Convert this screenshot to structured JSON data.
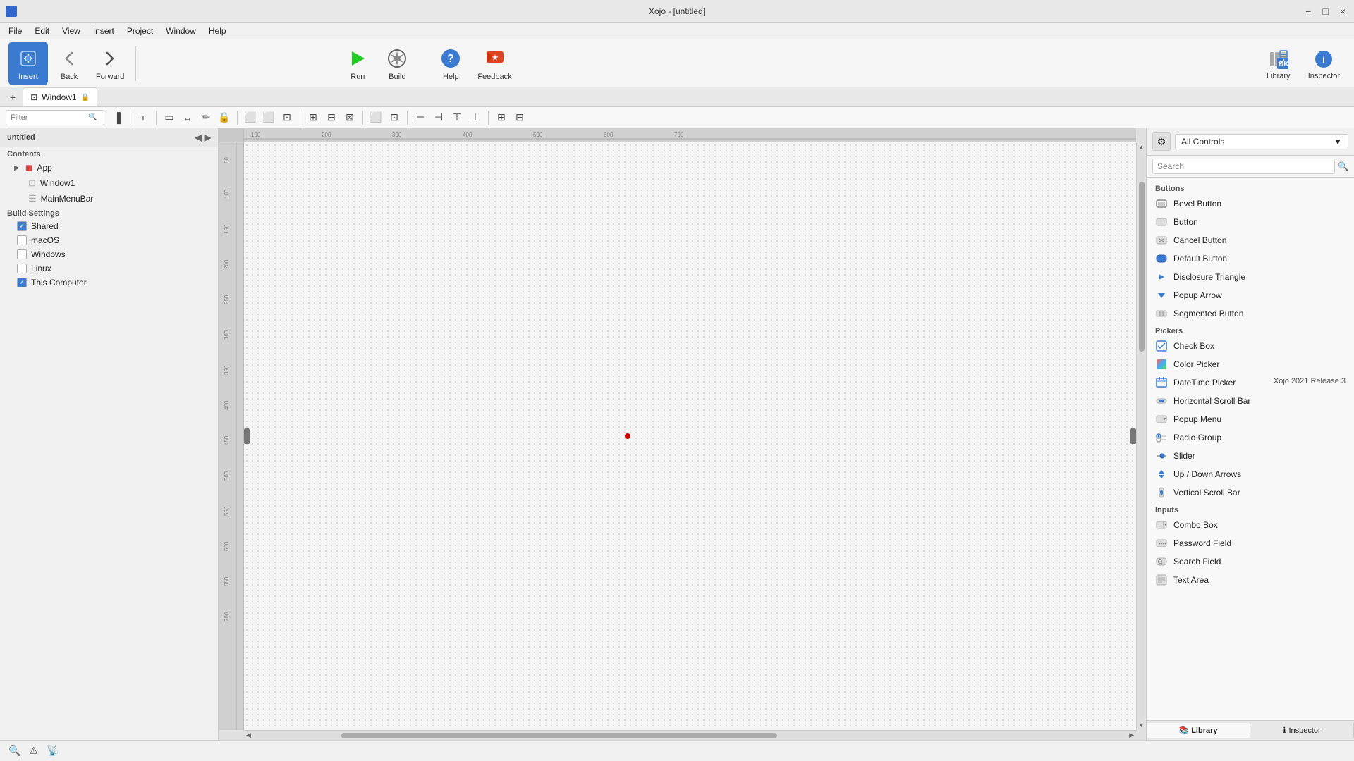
{
  "titlebar": {
    "title": "Xojo - [untitled]",
    "controls": [
      "−",
      "□",
      "×"
    ]
  },
  "menubar": {
    "items": [
      "File",
      "Edit",
      "View",
      "Insert",
      "Project",
      "Window",
      "Help"
    ]
  },
  "toolbar": {
    "insert_label": "Insert",
    "back_label": "Back",
    "forward_label": "Forward",
    "run_label": "Run",
    "build_label": "Build",
    "help_label": "Help",
    "feedback_label": "Feedback",
    "library_label": "Library",
    "inspector_label": "Inspector"
  },
  "tabbar": {
    "active_tab": "Window1",
    "add_label": "+"
  },
  "secondary_toolbar": {
    "filter_placeholder": "Filter"
  },
  "left_panel": {
    "title": "untitled",
    "contents_label": "Contents",
    "items": [
      {
        "id": "app",
        "label": "App",
        "type": "folder",
        "depth": 0
      },
      {
        "id": "window1",
        "label": "Window1",
        "type": "window",
        "depth": 1
      },
      {
        "id": "mainmenubar",
        "label": "MainMenuBar",
        "type": "menu",
        "depth": 1
      }
    ],
    "build_settings_label": "Build Settings",
    "build_items": [
      {
        "id": "shared",
        "label": "Shared",
        "checked": true
      },
      {
        "id": "macos",
        "label": "macOS",
        "checked": false
      },
      {
        "id": "windows",
        "label": "Windows",
        "checked": false
      },
      {
        "id": "linux",
        "label": "Linux",
        "checked": false
      },
      {
        "id": "thiscomputer",
        "label": "This Computer",
        "checked": true
      }
    ]
  },
  "controls_panel": {
    "dropdown_label": "All Controls",
    "search_placeholder": "Search",
    "sections": [
      {
        "label": "Buttons",
        "items": [
          {
            "label": "Bevel Button",
            "icon": "▭"
          },
          {
            "label": "Button",
            "icon": "▭"
          },
          {
            "label": "Cancel Button",
            "icon": "▭"
          },
          {
            "label": "Default Button",
            "icon": "◉"
          },
          {
            "label": "Disclosure Triangle",
            "icon": "▶"
          },
          {
            "label": "Popup Arrow",
            "icon": "▼"
          },
          {
            "label": "Segmented Button",
            "icon": "▭"
          }
        ]
      },
      {
        "label": "Pickers",
        "items": [
          {
            "label": "Check Box",
            "icon": "☑"
          },
          {
            "label": "Color Picker",
            "icon": "⬛"
          },
          {
            "label": "DateTime Picker",
            "icon": "📅"
          },
          {
            "label": "Horizontal Scroll Bar",
            "icon": "⟺"
          },
          {
            "label": "Popup Menu",
            "icon": "▼"
          },
          {
            "label": "Radio Group",
            "icon": "◉"
          },
          {
            "label": "Slider",
            "icon": "—"
          },
          {
            "label": "Up / Down Arrows",
            "icon": "↕"
          },
          {
            "label": "Vertical Scroll Bar",
            "icon": "↕"
          }
        ]
      },
      {
        "label": "Inputs",
        "items": [
          {
            "label": "Combo Box",
            "icon": "▭"
          },
          {
            "label": "Password Field",
            "icon": "▭"
          },
          {
            "label": "Search Field",
            "icon": "🔍"
          },
          {
            "label": "Text Area",
            "icon": "▭"
          }
        ]
      }
    ]
  },
  "right_tabs": [
    {
      "label": "Library",
      "icon": "📚"
    },
    {
      "label": "Inspector",
      "icon": "ℹ"
    }
  ],
  "bottom_bar": {
    "version": "Xojo 2021 Release 3",
    "icons": [
      "🔍",
      "⚠",
      "📡"
    ]
  }
}
